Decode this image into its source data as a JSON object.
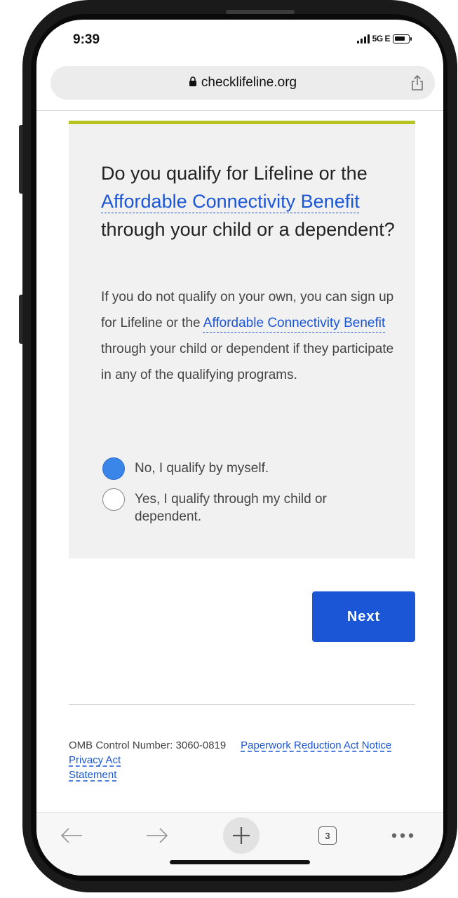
{
  "status": {
    "time": "9:39",
    "network": "5G E"
  },
  "browser": {
    "url": "checklifeline.org",
    "tabs_count": "3"
  },
  "question": {
    "part1": "Do you qualify for Lifeline or the ",
    "link": "Affordable Connectivity Benefit",
    "part2": " through your child or a dependent?"
  },
  "description": {
    "part1": "If you do not qualify on your own, you can sign up for Lifeline or the ",
    "link": "Affordable Connectivity Benefit",
    "part2": " through your child or dependent if they participate in any of the qualifying programs."
  },
  "options": [
    {
      "label": "No, I qualify by myself.",
      "selected": true
    },
    {
      "label": "Yes, I qualify through my child or dependent.",
      "selected": false
    }
  ],
  "next_label": "Next",
  "footer": {
    "omb": "OMB Control Number: 3060-0819",
    "paperwork": "Paperwork Reduction Act Notice",
    "privacy": "Privacy Act Statement"
  },
  "colors": {
    "accent": "#1a56d6",
    "card_top_border": "#b5c41f",
    "radio_selected": "#3a86e8"
  }
}
